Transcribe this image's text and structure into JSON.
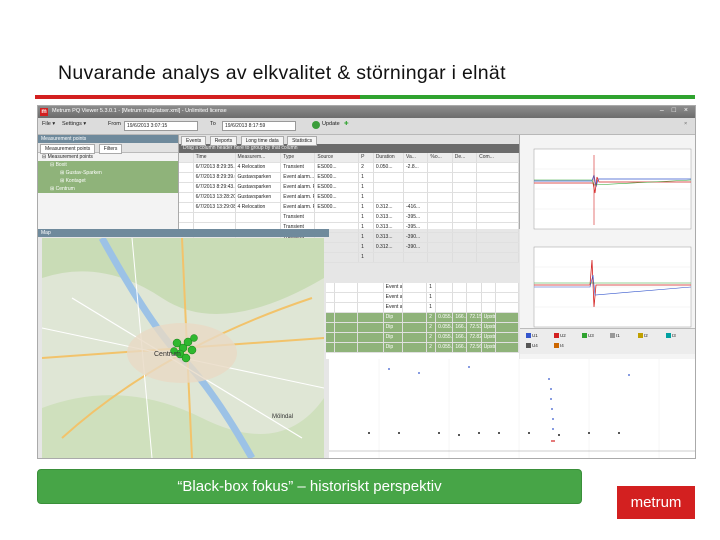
{
  "slide": {
    "title": "Nuvarande analys av elkvalitet & störningar i elnät",
    "banner": "“Black-box fokus” – historiskt perspektiv",
    "logo": "metrum",
    "colors": {
      "red": "#d32020",
      "green": "#47a547"
    }
  },
  "app": {
    "logo_letter": "m",
    "title": "Metrum PQ Viewer 5.3.0.1 - [Metrum mätplatser.xml] - Unlimited license",
    "window_buttons": "– □ ×",
    "toolbar": {
      "file": "File ▾",
      "settings": "Settings ▾",
      "from_label": "From",
      "from_value": "19/6/2013 3:07:15",
      "to_label": "To",
      "to_value": "19/6/2013 8:17:59",
      "update": "Update"
    }
  },
  "left_panel": {
    "header": "Measurement points",
    "tabs": [
      "Measurement points",
      "Filters"
    ],
    "tree": [
      "Measurement points",
      "Boxit",
      "Gustav-Sparken",
      "Kontaget",
      "Centrum"
    ]
  },
  "grid": {
    "tabs": [
      "Events",
      "Reports",
      "Long time data",
      "Statistics"
    ],
    "group_hint": "Drag a column header here to group by that column",
    "columns": [
      "",
      "Time",
      "Measurem...",
      "Type",
      "Source",
      "P",
      "Duration",
      "Va...",
      "%o...",
      "De...",
      "Com..."
    ],
    "rows": [
      [
        "",
        "6/7/2013 8:29:35...",
        "4 Relocation",
        "Transient",
        "ES000...",
        "2",
        "0.050...",
        "-2.8...",
        "",
        "",
        ""
      ],
      [
        "",
        "6/7/2013 8:29:39.07...",
        "Gustavsparken",
        "Event alarm...",
        "ES000...",
        "1",
        "",
        "",
        "",
        "",
        ""
      ],
      [
        "",
        "6/7/2013 8:29:43...",
        "Gustavsparken",
        "Event alarm. P...",
        "ES000...",
        "1",
        "",
        "",
        "",
        "",
        ""
      ],
      [
        "",
        "6/7/2013 13:28:20.07...",
        "Gustavsparken",
        "Event alarm. P...",
        "ES000...",
        "1",
        "",
        "",
        "",
        "",
        ""
      ],
      [
        "",
        "6/7/2013 13:29:08.48...",
        "4 Relocation",
        "Event alarm. P...",
        "ES000...",
        "1",
        "0.312...",
        "-416...",
        "",
        "",
        ""
      ],
      [
        "",
        "",
        "",
        "Transient",
        "",
        "1",
        "0.313...",
        "-395...",
        "",
        "",
        ""
      ],
      [
        "",
        "",
        "",
        "Transient",
        "",
        "1",
        "0.313...",
        "-395...",
        "",
        "",
        ""
      ],
      [
        "",
        "",
        "",
        "Transient",
        "",
        "1",
        "0.313...",
        "-390...",
        "",
        "",
        ""
      ],
      [
        "",
        "",
        "",
        "Transient",
        "",
        "1",
        "0.312...",
        "-390...",
        "",
        "",
        ""
      ],
      [
        "",
        "",
        "",
        "Event alarm. P...",
        "",
        "1",
        "",
        "",
        "",
        "",
        ""
      ]
    ]
  },
  "grid_lower": {
    "rows": [
      [
        "",
        "",
        "",
        "Event alarm. P...",
        "",
        "1",
        "",
        "",
        "",
        "",
        ""
      ],
      [
        "",
        "",
        "",
        "Event alarm. P...",
        "",
        "1",
        "",
        "",
        "",
        "",
        ""
      ],
      [
        "",
        "",
        "",
        "Event alarm. P...",
        "",
        "1",
        "",
        "",
        "",
        "",
        ""
      ],
      [
        "",
        "",
        "",
        "Dip",
        "",
        "2",
        "0.055...",
        "166...",
        "72.15 %",
        "Upstre...",
        ""
      ],
      [
        "",
        "",
        "",
        "Dip",
        "",
        "2",
        "0.055...",
        "166...",
        "72.53 %",
        "Upstre...",
        ""
      ],
      [
        "",
        "",
        "",
        "Dip",
        "",
        "2",
        "0.055...",
        "166...",
        "72.82 %",
        "Upstre...",
        ""
      ],
      [
        "",
        "",
        "",
        "Dip",
        "",
        "2",
        "0.055...",
        "166...",
        "72.56 %",
        "Upstre...",
        ""
      ]
    ]
  },
  "map": {
    "header": "Map",
    "labels": [
      "Centrum",
      "Mölndal"
    ]
  },
  "charts": {
    "legend": [
      "U1",
      "U2",
      "U3",
      "I1",
      "I2",
      "I3",
      "U4",
      "I4"
    ],
    "legend_colors": [
      "#3355cc",
      "#d32020",
      "#2fa32f",
      "#999999",
      "#c0a000",
      "#00a0a0",
      "#555555",
      "#cc6600"
    ]
  }
}
